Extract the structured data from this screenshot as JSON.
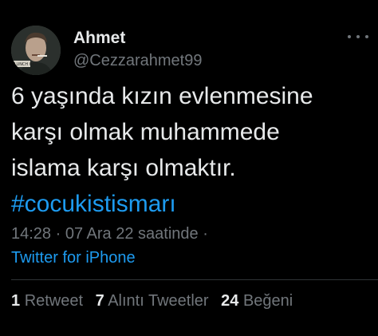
{
  "user": {
    "display_name": "Ahmet",
    "handle": "@Cezzarahmet99",
    "avatar_caption": "LUNCH OFF"
  },
  "tweet": {
    "lines": [
      "6 yaşında kızın evlenmesine",
      "karşı olmak muhammede",
      "islama karşı olmaktır."
    ],
    "hashtag": "#cocukistismarı"
  },
  "meta": {
    "time": "14:28",
    "separator": "·",
    "date": "07 Ara 22 saatinde",
    "trailing_separator": "·"
  },
  "source": "Twitter for iPhone",
  "stats": [
    {
      "count": "1",
      "label": "Retweet"
    },
    {
      "count": "7",
      "label": "Alıntı Tweetler"
    },
    {
      "count": "24",
      "label": "Beğeni"
    }
  ],
  "colors": {
    "background": "#000000",
    "text": "#e7e9ea",
    "secondary": "#71767b",
    "accent": "#1d9bf0",
    "divider": "#2f3336"
  },
  "icons": {
    "more": "more-horizontal-icon"
  }
}
